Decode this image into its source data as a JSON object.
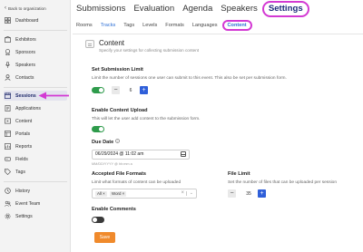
{
  "sidebar": {
    "back_label": "Back to organization",
    "items": [
      {
        "label": "Dashboard",
        "icon": "dashboard-icon"
      },
      {
        "label": "Exhibitors",
        "icon": "exhibitor-icon"
      },
      {
        "label": "Sponsors",
        "icon": "sponsor-icon"
      },
      {
        "label": "Speakers",
        "icon": "microphone-icon"
      },
      {
        "label": "Contacts",
        "icon": "contacts-icon"
      },
      {
        "label": "Sessions",
        "icon": "sessions-icon"
      },
      {
        "label": "Applications",
        "icon": "applications-icon"
      },
      {
        "label": "Content",
        "icon": "content-icon"
      },
      {
        "label": "Portals",
        "icon": "portals-icon"
      },
      {
        "label": "Reports",
        "icon": "reports-icon"
      },
      {
        "label": "Fields",
        "icon": "fields-icon"
      },
      {
        "label": "Tags",
        "icon": "tag-icon"
      },
      {
        "label": "History",
        "icon": "history-icon"
      },
      {
        "label": "Event Team",
        "icon": "team-icon"
      },
      {
        "label": "Settings",
        "icon": "gear-icon"
      }
    ],
    "active": "Sessions"
  },
  "topnav": {
    "tabs": [
      "Submissions",
      "Evaluation",
      "Agenda",
      "Speakers",
      "Settings"
    ],
    "active": "Settings"
  },
  "subnav": {
    "tabs": [
      "Rooms",
      "Tracks",
      "Tags",
      "Levels",
      "Formats",
      "Languages",
      "Content"
    ],
    "active": "Content"
  },
  "content": {
    "title": "Content",
    "subtitle": "Specify your settings for collecting submission content",
    "submission_limit": {
      "label": "Set Submission Limit",
      "description": "Limit the number of sessions one user can submit to this event. This also be set per submission form.",
      "enabled": true,
      "value": "6"
    },
    "content_upload": {
      "label": "Enable Content Upload",
      "description": "This will let the user add content to the submission form.",
      "enabled": true
    },
    "due_date": {
      "label": "Due Date",
      "value": "06/29/2024 @ 11:02 am",
      "hint": "MM/DD/YYYY @ hh:mm a"
    },
    "file_formats": {
      "label": "Accepted File Formats",
      "description": "Limit what formats of content can be uploaded",
      "chips": [
        "All",
        "Word"
      ]
    },
    "file_limit": {
      "label": "File Limit",
      "description": "Set the number of files that can be uploaded per session",
      "value": "35"
    },
    "comments": {
      "label": "Enable Comments",
      "enabled": false
    },
    "save_label": "Save"
  },
  "colors": {
    "accent_blue": "#2f5fd9",
    "highlight_magenta": "#d339d3",
    "toggle_green": "#2e9b4b",
    "save_orange": "#f08a2c"
  }
}
